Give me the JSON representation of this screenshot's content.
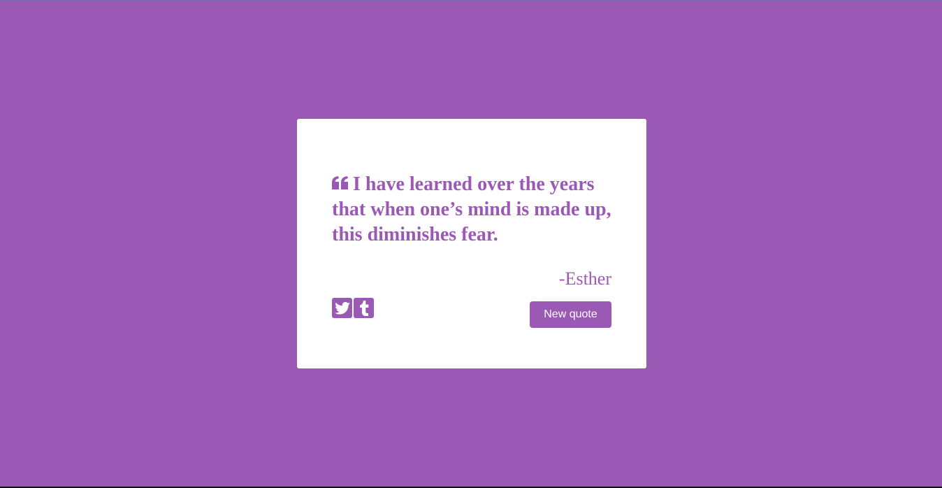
{
  "quote": {
    "text": "I have learned over the years that when one’s mind is made up, this diminishes fear.",
    "author": "-Esther",
    "quote_icon": "quote-left-icon"
  },
  "buttons": {
    "twitter_icon": "twitter-icon",
    "tumblr_icon": "tumblr-icon",
    "new_quote_label": "New quote"
  },
  "colors": {
    "background": "#9b59b6",
    "card": "#ffffff",
    "accent": "#9b59b6"
  }
}
